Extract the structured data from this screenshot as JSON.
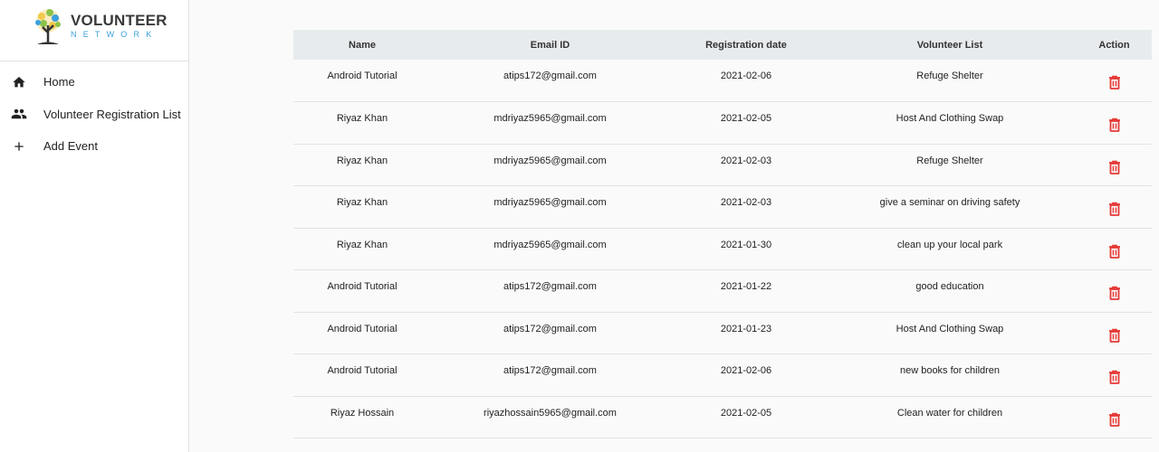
{
  "brand": {
    "title": "VOLUNTEER",
    "subtitle": "NETWORK"
  },
  "nav": [
    {
      "label": "Home",
      "icon": "home-icon"
    },
    {
      "label": "Volunteer Registration List",
      "icon": "people-icon"
    },
    {
      "label": "Add Event",
      "icon": "plus-icon"
    }
  ],
  "table": {
    "headers": [
      "Name",
      "Email ID",
      "Registration date",
      "Volunteer List",
      "Action"
    ],
    "rows": [
      {
        "name": "Android Tutorial",
        "email": "atips172@gmail.com",
        "date": "2021-02-06",
        "event": "Refuge Shelter"
      },
      {
        "name": "Riyaz Khan",
        "email": "mdriyaz5965@gmail.com",
        "date": "2021-02-05",
        "event": "Host And Clothing Swap"
      },
      {
        "name": "Riyaz Khan",
        "email": "mdriyaz5965@gmail.com",
        "date": "2021-02-03",
        "event": "Refuge Shelter"
      },
      {
        "name": "Riyaz Khan",
        "email": "mdriyaz5965@gmail.com",
        "date": "2021-02-03",
        "event": "give a seminar on driving safety"
      },
      {
        "name": "Riyaz Khan",
        "email": "mdriyaz5965@gmail.com",
        "date": "2021-01-30",
        "event": "clean up your local park"
      },
      {
        "name": "Android Tutorial",
        "email": "atips172@gmail.com",
        "date": "2021-01-22",
        "event": "good education"
      },
      {
        "name": "Android Tutorial",
        "email": "atips172@gmail.com",
        "date": "2021-01-23",
        "event": "Host And Clothing Swap"
      },
      {
        "name": "Android Tutorial",
        "email": "atips172@gmail.com",
        "date": "2021-02-06",
        "event": "new books for children"
      },
      {
        "name": "Riyaz Hossain",
        "email": "riyazhossain5965@gmail.com",
        "date": "2021-02-05",
        "event": "Clean water for children"
      }
    ],
    "action_icon": "trash-icon"
  },
  "colors": {
    "delete": "#e53935",
    "header_bg": "#e8ebee",
    "brand_blue": "#3aa0dd"
  }
}
